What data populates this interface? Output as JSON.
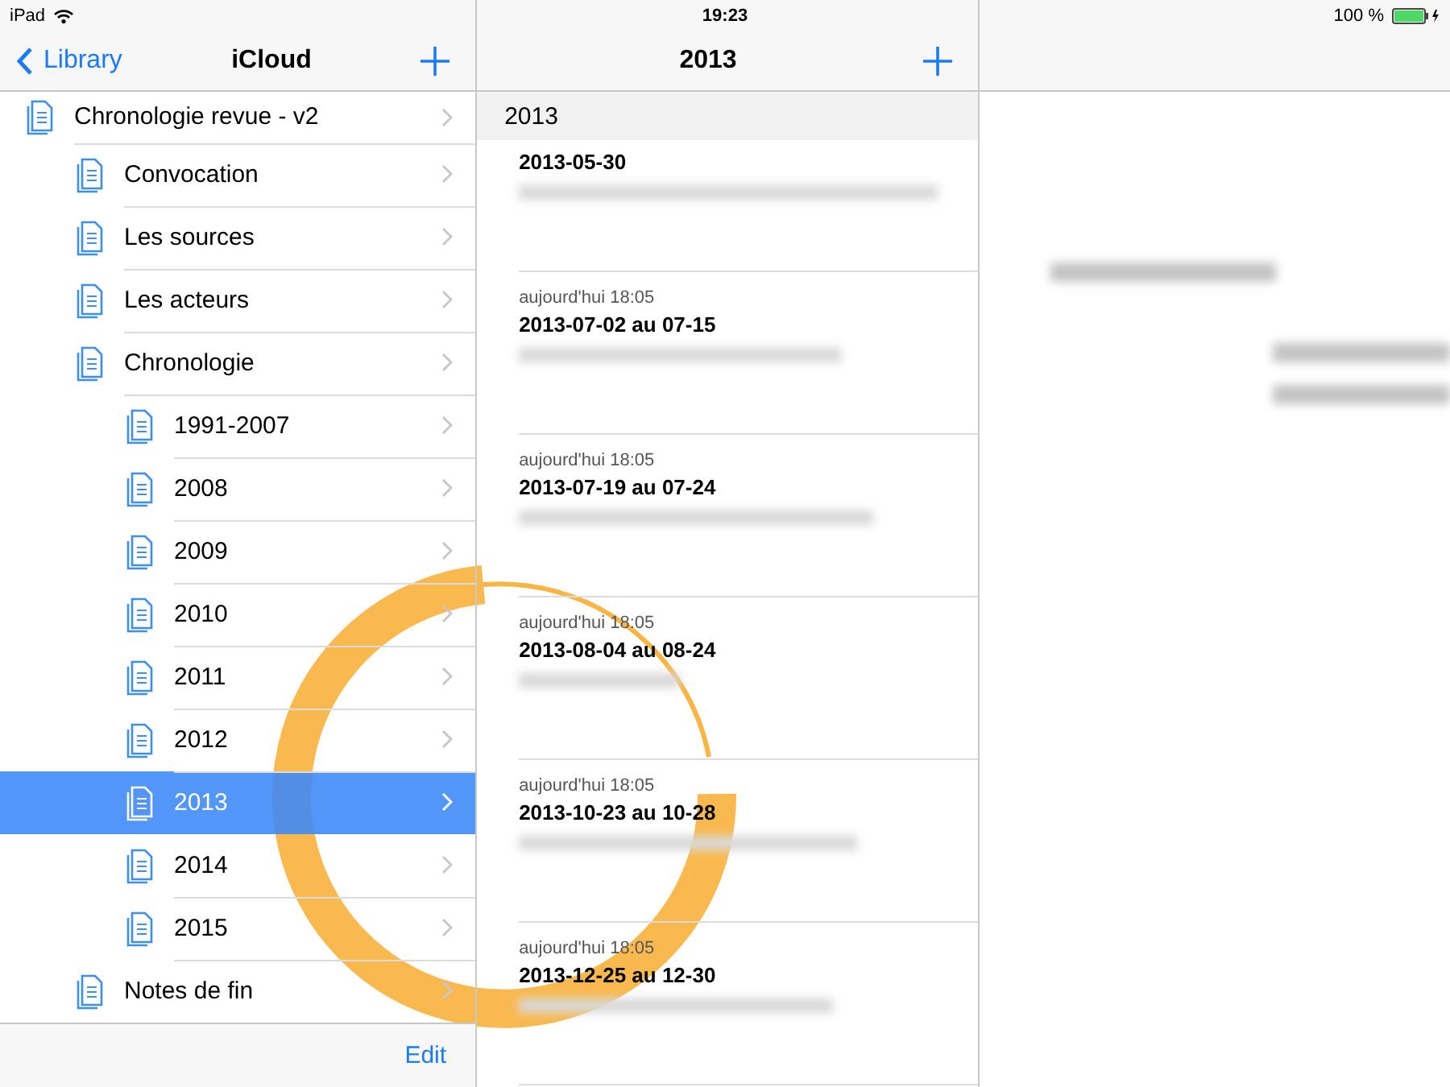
{
  "status_bar": {
    "device": "iPad",
    "time": "19:23",
    "battery_text": "100 %"
  },
  "left_nav": {
    "back": "Library",
    "title": "iCloud"
  },
  "tree": [
    {
      "label": "Chronologie revue - v2",
      "selected": false,
      "children": [
        {
          "label": "Convocation",
          "selected": false
        },
        {
          "label": "Les sources",
          "selected": false
        },
        {
          "label": "Les acteurs",
          "selected": false
        },
        {
          "label": "Chronologie",
          "selected": false,
          "children": [
            {
              "label": "1991-2007",
              "selected": false
            },
            {
              "label": "2008",
              "selected": false
            },
            {
              "label": "2009",
              "selected": false
            },
            {
              "label": "2010",
              "selected": false
            },
            {
              "label": "2011",
              "selected": false
            },
            {
              "label": "2012",
              "selected": false
            },
            {
              "label": "2013",
              "selected": true
            },
            {
              "label": "2014",
              "selected": false
            },
            {
              "label": "2015",
              "selected": false
            }
          ]
        },
        {
          "label": "Notes de fin",
          "selected": false
        }
      ]
    }
  ],
  "left_toolbar": {
    "edit": "Edit"
  },
  "middle_nav": {
    "title": "2013"
  },
  "section_header": "2013",
  "notes": [
    {
      "title": "2013-05-30"
    },
    {
      "timestamp": "aujourd'hui 18:05",
      "title": "2013-07-02 au 07-15"
    },
    {
      "timestamp": "aujourd'hui 18:05",
      "title": "2013-07-19 au 07-24"
    },
    {
      "timestamp": "aujourd'hui 18:05",
      "title": "2013-08-04 au 08-24"
    },
    {
      "timestamp": "aujourd'hui 18:05",
      "title": "2013-10-23 au 10-28"
    },
    {
      "timestamp": "aujourd'hui 18:05",
      "title": "2013-12-25 au 12-30"
    }
  ]
}
